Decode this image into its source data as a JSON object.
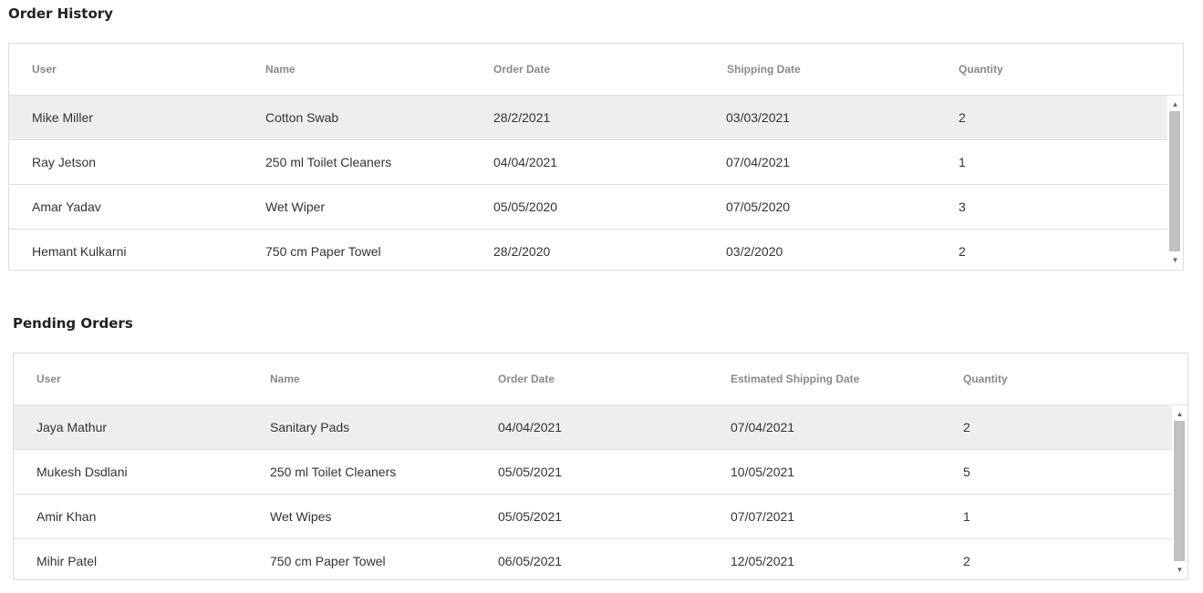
{
  "order_history": {
    "title": "Order History",
    "columns": [
      "User",
      "Name",
      "Order Date",
      "Shipping Date",
      "Quantity"
    ],
    "rows": [
      [
        "Mike Miller",
        "Cotton Swab",
        "28/2/2021",
        "03/03/2021",
        "2"
      ],
      [
        "Ray Jetson",
        "250 ml Toilet Cleaners",
        "04/04/2021",
        "07/04/2021",
        "1"
      ],
      [
        "Amar Yadav",
        "Wet Wiper",
        "05/05/2020",
        "07/05/2020",
        "3"
      ],
      [
        "Hemant Kulkarni",
        "750 cm Paper Towel",
        "28/2/2020",
        "03/2/2020",
        "2"
      ]
    ],
    "selected_row": 0
  },
  "pending_orders": {
    "title": "Pending Orders",
    "columns": [
      "User",
      "Name",
      "Order Date",
      "Estimated Shipping Date",
      "Quantity"
    ],
    "rows": [
      [
        "Jaya Mathur",
        "Sanitary Pads",
        "04/04/2021",
        "07/04/2021",
        "2"
      ],
      [
        "Mukesh Dsdlani",
        "250 ml Toilet Cleaners",
        "05/05/2021",
        "10/05/2021",
        "5"
      ],
      [
        "Amir Khan",
        "Wet Wipes",
        "05/05/2021",
        "07/07/2021",
        "1"
      ],
      [
        "Mihir Patel",
        "750 cm Paper Towel",
        "06/05/2021",
        "12/05/2021",
        "2"
      ]
    ],
    "selected_row": 0
  },
  "icons": {
    "scroll_up": "▲",
    "scroll_down": "▼"
  },
  "colors": {
    "selected_row": "#eeeeee",
    "header_text": "#8a8a8a",
    "border": "#dcdcdc",
    "scroll_thumb": "#c1c1c1"
  }
}
